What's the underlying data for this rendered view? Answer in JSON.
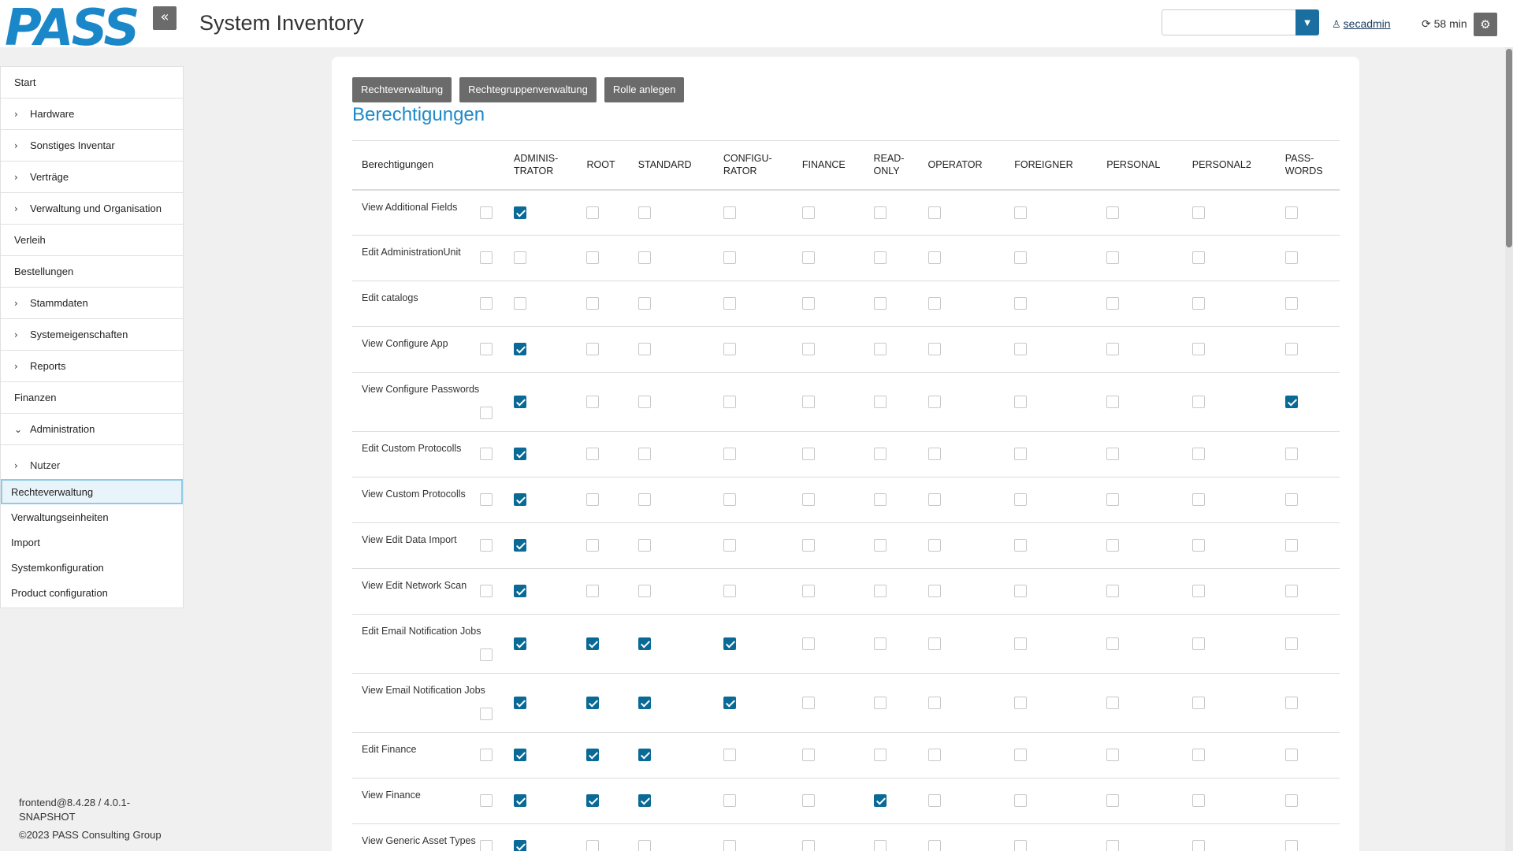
{
  "header": {
    "logo": "PASS",
    "title": "System Inventory",
    "select_value": "",
    "user": "secadmin",
    "timer": "58 min",
    "collapse_symbol": "«",
    "settings_symbol": "⚙"
  },
  "sidebar": {
    "items": [
      {
        "label": "Start",
        "chevron": ""
      },
      {
        "label": "Hardware",
        "chevron": "›"
      },
      {
        "label": "Sonstiges Inventar",
        "chevron": "›"
      },
      {
        "label": "Verträge",
        "chevron": "›"
      },
      {
        "label": "Verwaltung und Organisation",
        "chevron": "›"
      },
      {
        "label": "Verleih",
        "chevron": ""
      },
      {
        "label": "Bestellungen",
        "chevron": ""
      },
      {
        "label": "Stammdaten",
        "chevron": "›"
      },
      {
        "label": "Systemeigenschaften",
        "chevron": "›"
      },
      {
        "label": "Reports",
        "chevron": "›"
      },
      {
        "label": "Finanzen",
        "chevron": ""
      },
      {
        "label": "Administration",
        "chevron": "⌄"
      }
    ],
    "sub": {
      "label": "Nutzer"
    },
    "links": [
      {
        "label": "Rechteverwaltung"
      },
      {
        "label": "Verwaltungseinheiten"
      },
      {
        "label": "Import"
      },
      {
        "label": "Systemkonfiguration"
      },
      {
        "label": "Product configuration"
      }
    ],
    "version": "frontend@8.4.28 / 4.0.1-",
    "version2": "SNAPSHOT",
    "copyright": "©2023 PASS Consulting Group"
  },
  "main": {
    "buttons": [
      "Rechteverwaltung",
      "Rechtegruppenverwaltung",
      "Rolle anlegen"
    ],
    "title": "Berechtigungen",
    "columns": [
      {
        "l1": "ADMINIS-",
        "l2": "TRATOR"
      },
      {
        "l1": "ROOT",
        "l2": ""
      },
      {
        "l1": "STANDARD",
        "l2": ""
      },
      {
        "l1": "CONFIGU-",
        "l2": "RATOR"
      },
      {
        "l1": "FINANCE",
        "l2": ""
      },
      {
        "l1": "READ-",
        "l2": "ONLY"
      },
      {
        "l1": "OPERATOR",
        "l2": ""
      },
      {
        "l1": "FOREIGNER",
        "l2": ""
      },
      {
        "l1": "PERSONAL",
        "l2": ""
      },
      {
        "l1": "PERSONAL2",
        "l2": ""
      },
      {
        "l1": "PASS-",
        "l2": "WORDS"
      }
    ],
    "first_header": "Berechtigungen",
    "rows": [
      {
        "name": "View Additional Fields",
        "tall": false,
        "checks": [
          1,
          0,
          0,
          0,
          0,
          0,
          0,
          0,
          0,
          0,
          0
        ]
      },
      {
        "name": "Edit AdministrationUnit",
        "tall": false,
        "checks": [
          0,
          0,
          0,
          0,
          0,
          0,
          0,
          0,
          0,
          0,
          0
        ]
      },
      {
        "name": "Edit catalogs",
        "tall": false,
        "checks": [
          0,
          0,
          0,
          0,
          0,
          0,
          0,
          0,
          0,
          0,
          0
        ]
      },
      {
        "name": "View Configure App",
        "tall": false,
        "checks": [
          1,
          0,
          0,
          0,
          0,
          0,
          0,
          0,
          0,
          0,
          0
        ]
      },
      {
        "name": "View Configure Passwords",
        "tall": true,
        "checks": [
          1,
          0,
          0,
          0,
          0,
          0,
          0,
          0,
          0,
          0,
          1
        ]
      },
      {
        "name": "Edit Custom Protocolls",
        "tall": false,
        "checks": [
          1,
          0,
          0,
          0,
          0,
          0,
          0,
          0,
          0,
          0,
          0
        ]
      },
      {
        "name": "View Custom Protocolls",
        "tall": false,
        "checks": [
          1,
          0,
          0,
          0,
          0,
          0,
          0,
          0,
          0,
          0,
          0
        ]
      },
      {
        "name": "View Edit Data Import",
        "tall": false,
        "checks": [
          1,
          0,
          0,
          0,
          0,
          0,
          0,
          0,
          0,
          0,
          0
        ]
      },
      {
        "name": "View Edit Network Scan",
        "tall": false,
        "checks": [
          1,
          0,
          0,
          0,
          0,
          0,
          0,
          0,
          0,
          0,
          0
        ]
      },
      {
        "name": "Edit Email Notification Jobs",
        "tall": true,
        "checks": [
          1,
          1,
          1,
          1,
          0,
          0,
          0,
          0,
          0,
          0,
          0
        ]
      },
      {
        "name": "View Email Notification Jobs",
        "tall": true,
        "checks": [
          1,
          1,
          1,
          1,
          0,
          0,
          0,
          0,
          0,
          0,
          0
        ]
      },
      {
        "name": "Edit Finance",
        "tall": false,
        "checks": [
          1,
          1,
          1,
          0,
          0,
          0,
          0,
          0,
          0,
          0,
          0
        ]
      },
      {
        "name": "View Finance",
        "tall": false,
        "checks": [
          1,
          1,
          1,
          0,
          0,
          1,
          0,
          0,
          0,
          0,
          0
        ]
      },
      {
        "name": "View Generic Asset Types",
        "tall": false,
        "checks": [
          1,
          0,
          0,
          0,
          0,
          0,
          0,
          0,
          0,
          0,
          0
        ]
      }
    ]
  }
}
